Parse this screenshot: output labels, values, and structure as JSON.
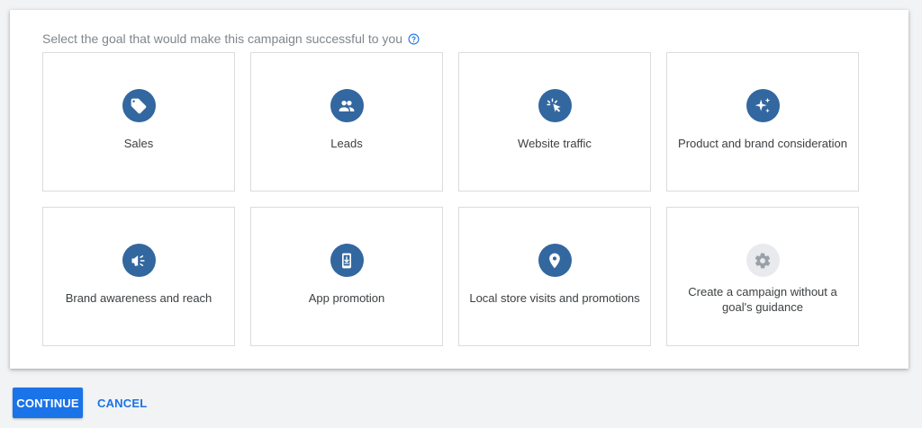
{
  "prompt": {
    "text": "Select the goal that would make this campaign successful to you",
    "help_icon": "help-circle-icon"
  },
  "goals": [
    {
      "label": "Sales",
      "icon": "tag-icon"
    },
    {
      "label": "Leads",
      "icon": "people-icon"
    },
    {
      "label": "Website traffic",
      "icon": "cursor-click-icon"
    },
    {
      "label": "Product and brand consideration",
      "icon": "sparkle-icon"
    },
    {
      "label": "Brand awareness and reach",
      "icon": "megaphone-icon"
    },
    {
      "label": "App promotion",
      "icon": "phone-download-icon"
    },
    {
      "label": "Local store visits and promotions",
      "icon": "location-pin-icon"
    },
    {
      "label": "Create a campaign without a goal's guidance",
      "icon": "gear-icon"
    }
  ],
  "actions": {
    "continue_label": "CONTINUE",
    "cancel_label": "CANCEL"
  },
  "colors": {
    "accent": "#1a73e8",
    "icon_circle": "#33679f",
    "icon_circle_disabled": "#e8eaed",
    "page_background": "#f1f3f4"
  }
}
